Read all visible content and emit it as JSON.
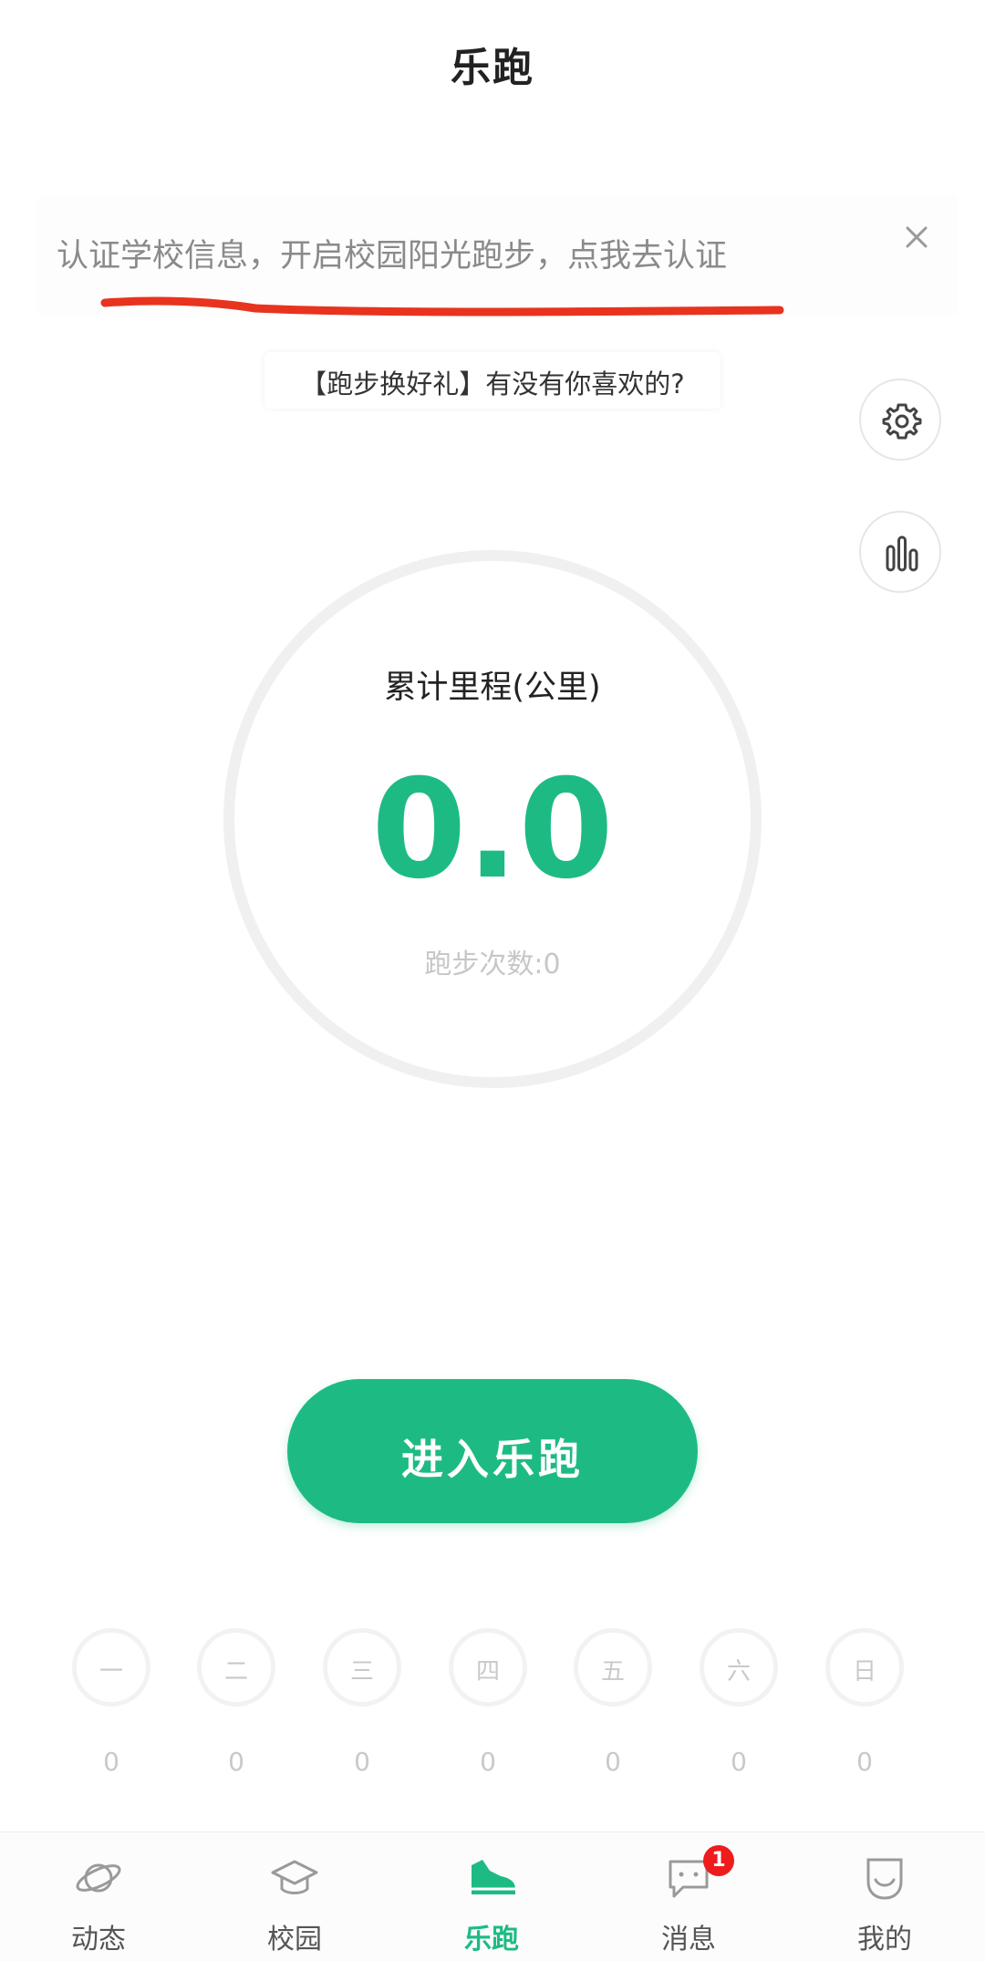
{
  "header": {
    "title": "乐跑"
  },
  "banner": {
    "text": "认证学校信息，开启校园阳光跑步，点我去认证"
  },
  "promo": {
    "text": "【跑步换好礼】有没有你喜欢的?"
  },
  "summary": {
    "label": "累计里程(公里)",
    "value": "0.0",
    "runs_text": "跑步次数:0"
  },
  "start_button": {
    "label": "进入乐跑"
  },
  "week": [
    {
      "day": "一",
      "count": "0"
    },
    {
      "day": "二",
      "count": "0"
    },
    {
      "day": "三",
      "count": "0"
    },
    {
      "day": "四",
      "count": "0"
    },
    {
      "day": "五",
      "count": "0"
    },
    {
      "day": "六",
      "count": "0"
    },
    {
      "day": "日",
      "count": "0"
    }
  ],
  "nav": {
    "items": [
      {
        "label": "动态",
        "icon": "planet-icon"
      },
      {
        "label": "校园",
        "icon": "graduation-cap-icon"
      },
      {
        "label": "乐跑",
        "icon": "running-shoe-icon",
        "active": true
      },
      {
        "label": "消息",
        "icon": "chat-bubble-icon",
        "badge": "1"
      },
      {
        "label": "我的",
        "icon": "smile-face-icon"
      }
    ]
  },
  "colors": {
    "accent": "#1dbb83",
    "badge": "#ee1c1c",
    "annotation": "#e8331f"
  }
}
